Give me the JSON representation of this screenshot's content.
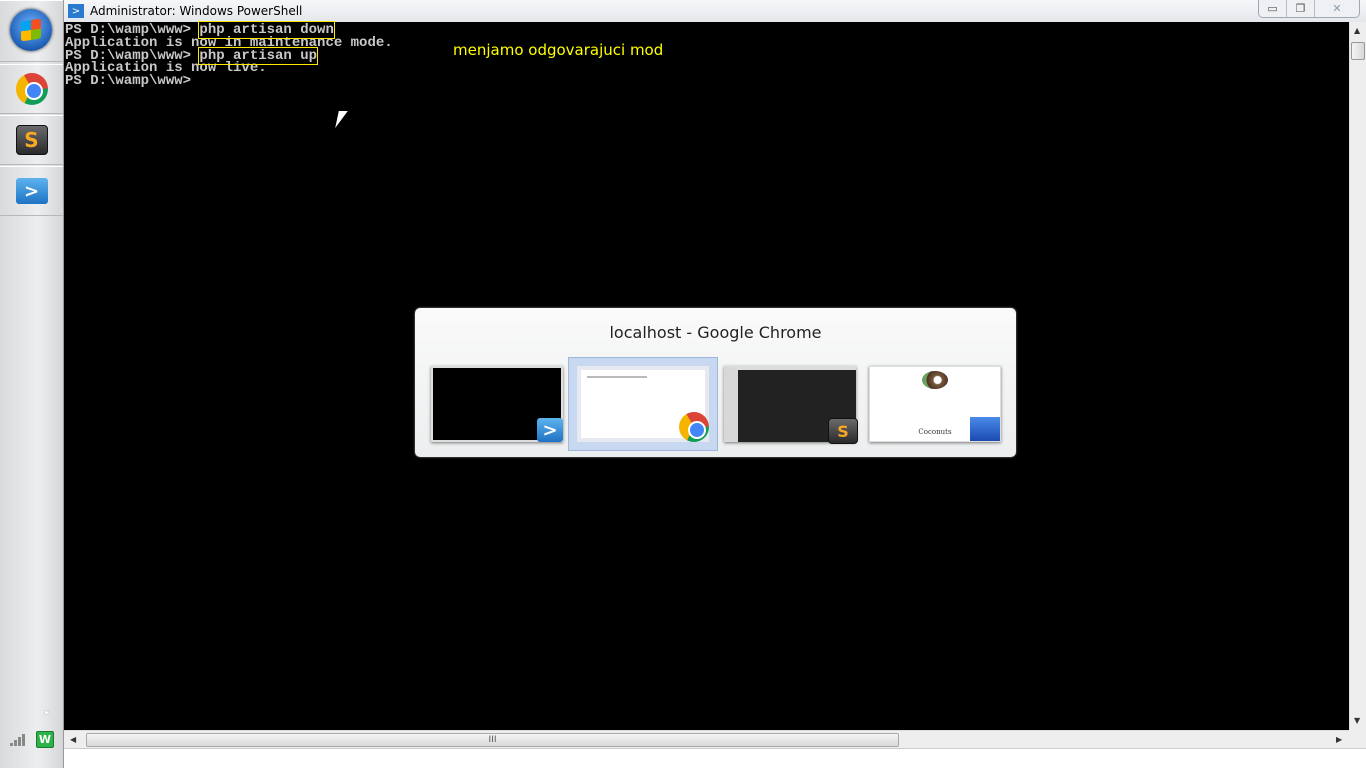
{
  "window": {
    "title": "Administrator: Windows PowerShell",
    "minimize_icon": "minimize-icon",
    "maximize_icon": "restore-icon",
    "close_icon": "close-icon"
  },
  "taskbar": {
    "items": [
      {
        "name": "start-orb"
      },
      {
        "name": "google-chrome",
        "icon": "chrome-icon"
      },
      {
        "name": "sublime-text",
        "icon": "sublime-icon",
        "glyph": "S"
      },
      {
        "name": "windows-powershell",
        "icon": "powershell-icon",
        "glyph": ">_"
      }
    ],
    "tray": {
      "show_hidden": "▸",
      "wamp_glyph": "W"
    }
  },
  "console": {
    "lines": [
      {
        "prompt": "PS D:\\wamp\\www> ",
        "command": "php artisan down",
        "highlight": true
      },
      {
        "text": "Application is now in maintenance mode."
      },
      {
        "prompt": "PS D:\\wamp\\www> ",
        "command": "php artisan up",
        "highlight": true
      },
      {
        "text": "Application is now live."
      },
      {
        "prompt": "PS D:\\wamp\\www>",
        "command": ""
      }
    ],
    "caption": "menjamo odgovarajuci mod",
    "caption_color": "#ffff00",
    "highlight_color": "#ffe800"
  },
  "switcher": {
    "title": "localhost - Google Chrome",
    "windows": [
      {
        "app": "Windows PowerShell",
        "selected": false
      },
      {
        "app": "Google Chrome",
        "selected": true
      },
      {
        "app": "Sublime Text",
        "selected": false
      },
      {
        "app": "Coconuts page",
        "selected": false,
        "label": "Coconuts"
      }
    ]
  },
  "scrollbar": {
    "grip": "III"
  }
}
